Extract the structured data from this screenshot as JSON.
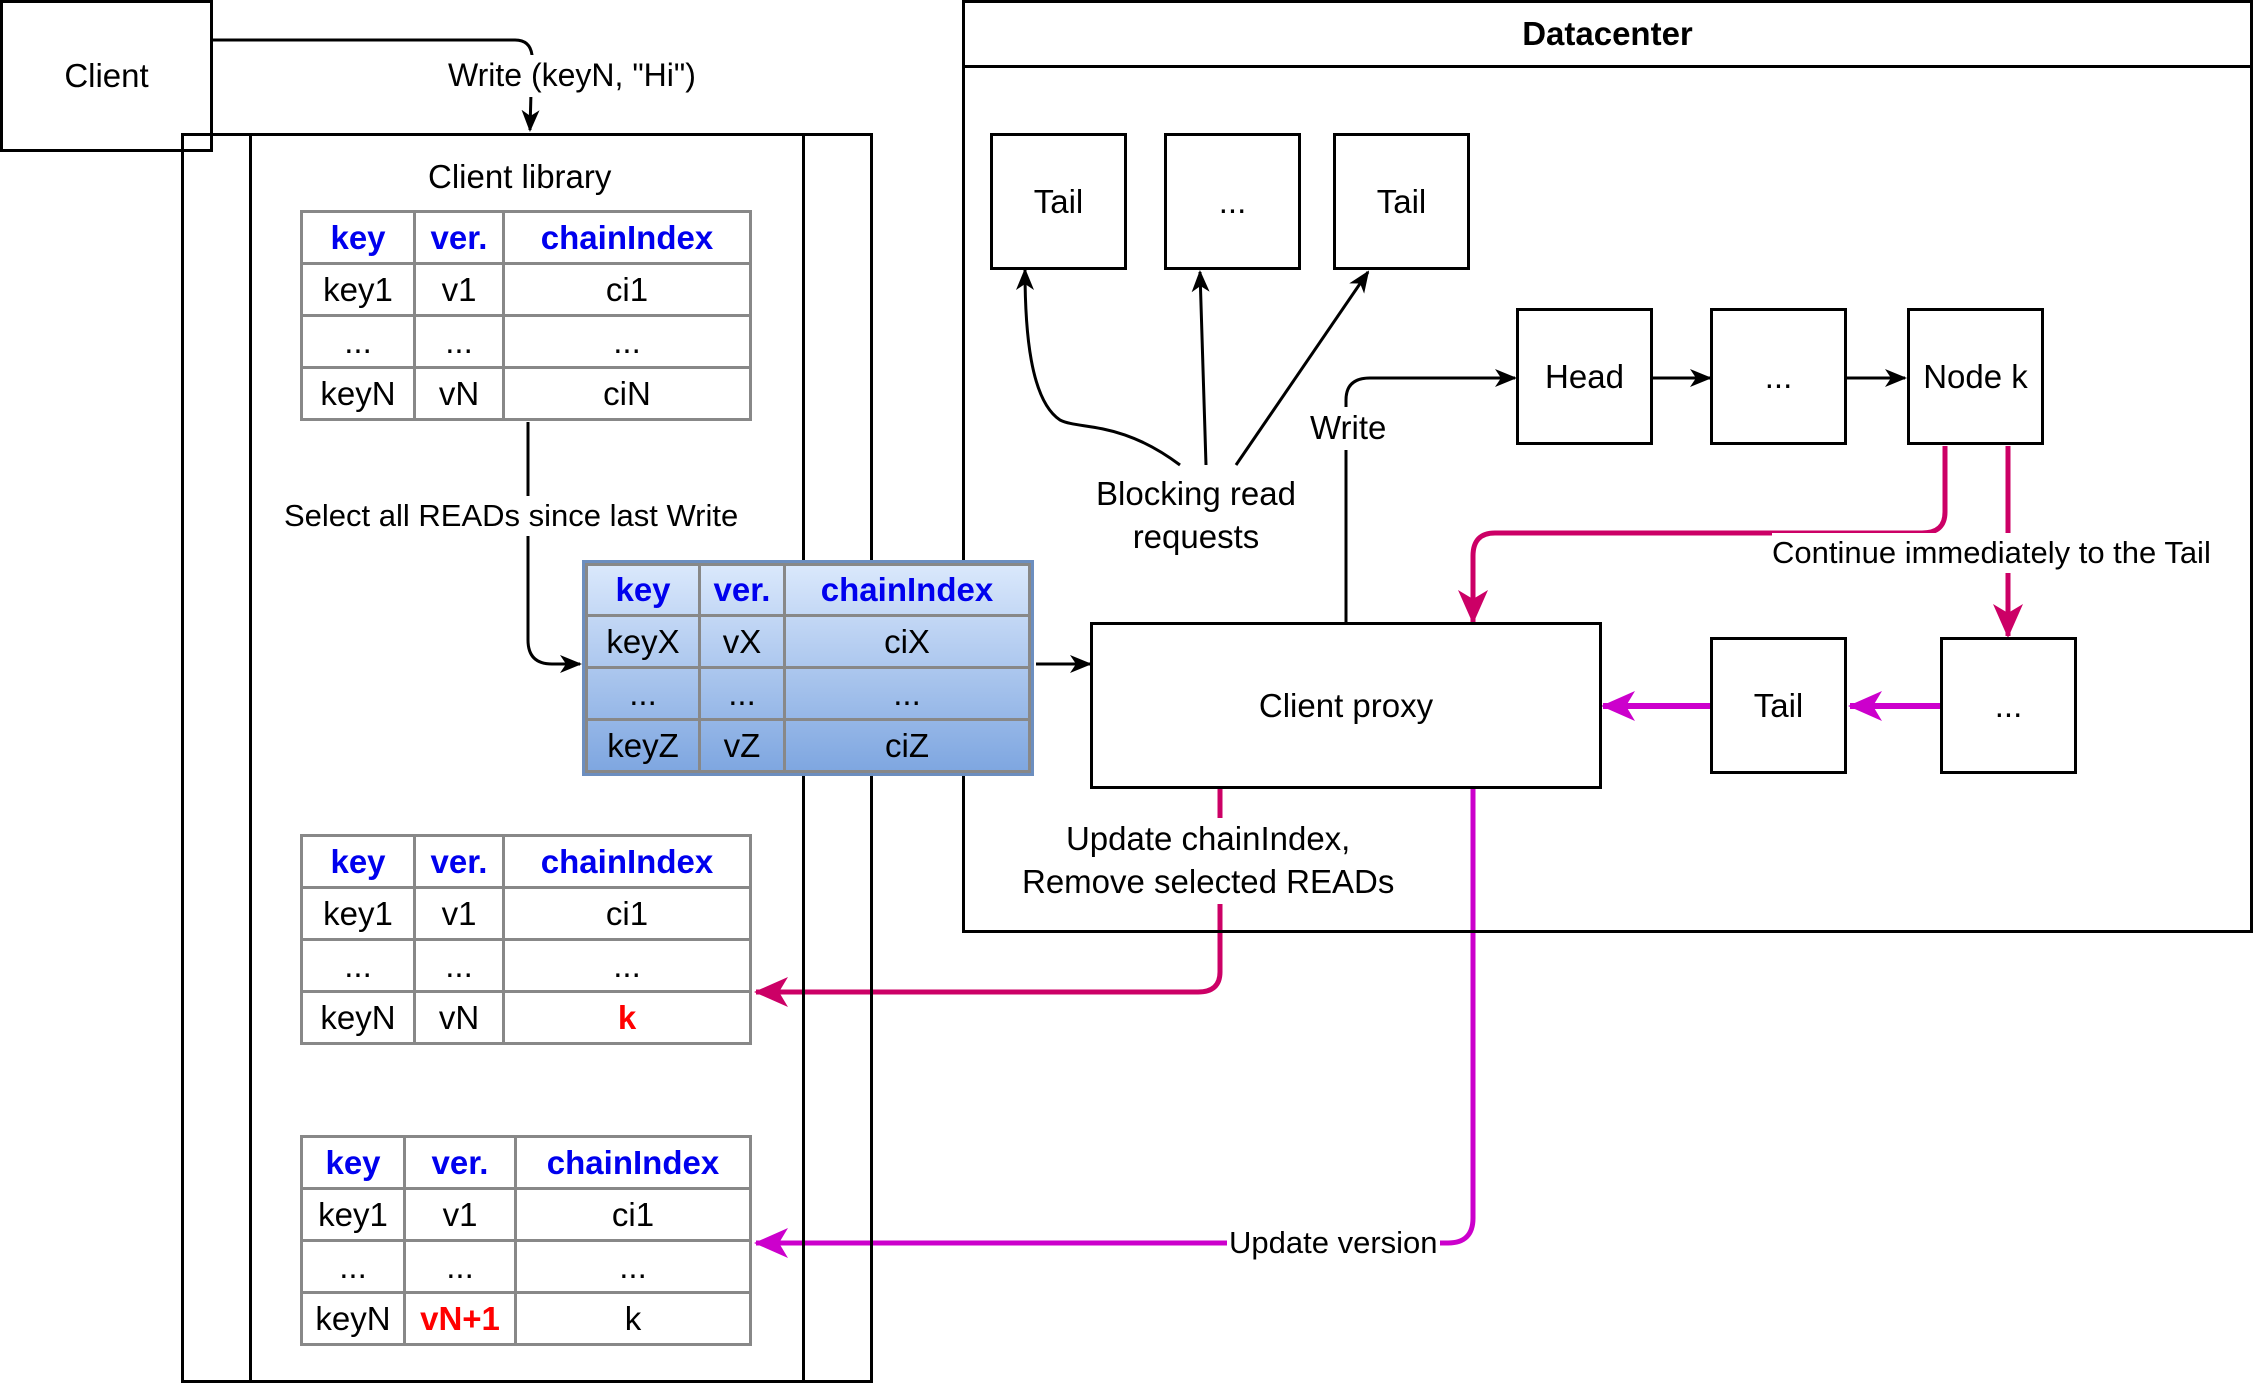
{
  "client": {
    "label": "Client"
  },
  "write_request": {
    "label": "Write (keyN, \"Hi\")"
  },
  "client_library": {
    "title": "Client library",
    "columns": [
      "key",
      "ver.",
      "chainIndex"
    ],
    "table_initial": [
      [
        "key1",
        "v1",
        "ci1"
      ],
      [
        "...",
        "...",
        "..."
      ],
      [
        "keyN",
        "vN",
        "ciN"
      ]
    ],
    "select_label": "Select all READs since last Write",
    "table_selected": [
      [
        "keyX",
        "vX",
        "ciX"
      ],
      [
        "...",
        "...",
        "..."
      ],
      [
        "keyZ",
        "vZ",
        "ciZ"
      ]
    ],
    "table_updated_index": [
      [
        "key1",
        "v1",
        "ci1"
      ],
      [
        "...",
        "...",
        "..."
      ],
      [
        "keyN",
        "vN",
        "k"
      ]
    ],
    "table_updated_version": [
      [
        "key1",
        "v1",
        "ci1"
      ],
      [
        "...",
        "...",
        "..."
      ],
      [
        "keyN",
        "vN+1",
        "k"
      ]
    ]
  },
  "datacenter": {
    "title": "Datacenter",
    "read_tails": [
      "Tail",
      "...",
      "Tail"
    ],
    "chain": [
      "Head",
      "...",
      "Node k"
    ],
    "tail_chain": [
      "Tail",
      "..."
    ],
    "client_proxy": "Client proxy",
    "blocking_read_label": "Blocking read\nrequests",
    "write_label": "Write",
    "continue_label": "Continue immediately to the Tail",
    "update_index_label": "Update chainIndex,\nRemove selected READs",
    "update_version_label": "Update version"
  },
  "colors": {
    "header_text": "#0000ee",
    "highlight_text": "#ff0000",
    "crimson_arrow": "#cc0066",
    "magenta_arrow": "#cc00cc",
    "selected_table_fill_top": "#dae8fc",
    "selected_table_fill_bottom": "#7ea6e0"
  }
}
